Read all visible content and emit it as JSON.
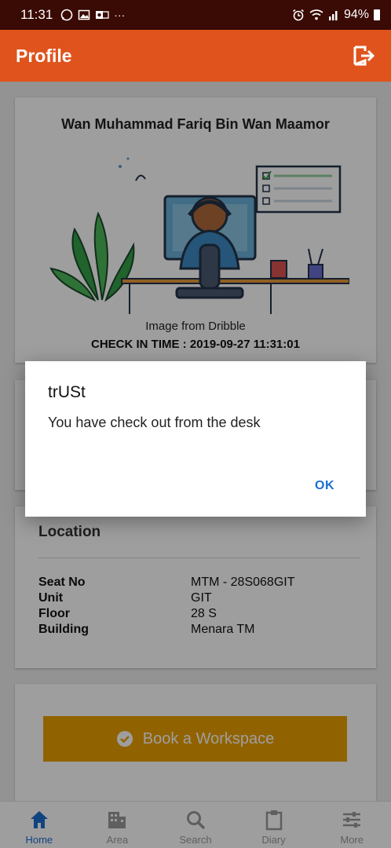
{
  "status": {
    "time": "11:31",
    "more": "···",
    "battery": "94%"
  },
  "app_bar": {
    "title": "Profile"
  },
  "profile": {
    "name": "Wan Muhammad Fariq Bin Wan Maamor",
    "image_credit": "Image from Dribble",
    "checkin": "CHECK IN TIME : 2019-09-27 11:31:01"
  },
  "location": {
    "heading": "Location",
    "rows": [
      {
        "key": "Seat No",
        "value": "MTM - 28S068GIT"
      },
      {
        "key": "Unit",
        "value": "GIT"
      },
      {
        "key": "Floor",
        "value": "28 S"
      },
      {
        "key": "Building",
        "value": "Menara TM"
      }
    ]
  },
  "book_button": {
    "label": "Book a Workspace"
  },
  "nav": [
    {
      "label": "Home",
      "icon": "home-icon"
    },
    {
      "label": "Area",
      "icon": "building-icon"
    },
    {
      "label": "Search",
      "icon": "search-icon"
    },
    {
      "label": "Diary",
      "icon": "clipboard-icon"
    },
    {
      "label": "More",
      "icon": "sliders-icon"
    }
  ],
  "dialog": {
    "title": "trUSt",
    "message": "You have check out from the desk",
    "ok_label": "OK"
  },
  "colors": {
    "app_bar": "#e0531d",
    "status_bar": "#3a0a04",
    "accent_button": "#eaa000",
    "nav_active": "#1b6fd1"
  }
}
